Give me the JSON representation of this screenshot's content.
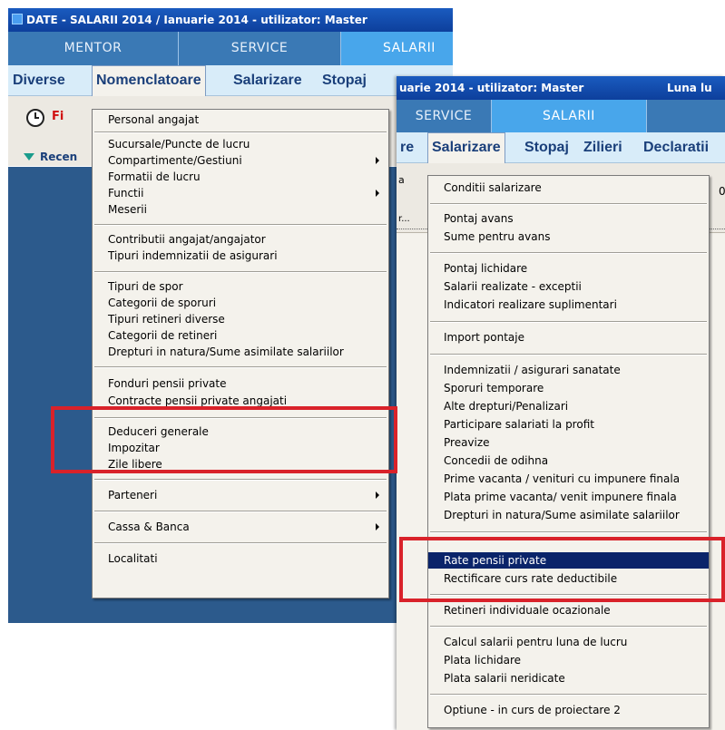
{
  "window1": {
    "title": "DATE - SALARII 2014 / Ianuarie 2014 - utilizator: Master",
    "module_tabs": [
      "MENTOR",
      "SERVICE",
      "SALARII"
    ],
    "menu": [
      "Diverse",
      "Nomenclatoare",
      "Salarizare",
      "Stopaj"
    ],
    "toolbar_label": "Fi",
    "recent_label": "Recen",
    "dropdown": [
      "Personal angajat",
      "Sucursale/Puncte de lucru",
      "Compartimente/Gestiuni",
      "Formatii de lucru",
      "Functii",
      "Meserii",
      "Contributii angajat/angajator",
      "Tipuri indemnizatii de asigurari",
      "Tipuri de spor",
      "Categorii de sporuri",
      "Tipuri retineri diverse",
      "Categorii de retineri",
      "Drepturi in natura/Sume asimilate salariilor",
      "Fonduri pensii private",
      "Contracte pensii private angajati",
      "Deduceri generale",
      "Impozitar",
      "Zile libere",
      "Parteneri",
      "Cassa & Banca",
      "Localitati"
    ]
  },
  "window2": {
    "title": "uarie 2014 - utilizator: Master",
    "title_right": "Luna lu",
    "module_tabs": [
      "SERVICE",
      "SALARII"
    ],
    "menu": [
      "re",
      "Salarizare",
      "Stopaj",
      "Zilieri",
      "Declaratii"
    ],
    "frag_a": "a",
    "frag_b": "r...",
    "frag_c": "0",
    "dropdown": [
      "Conditii salarizare",
      "Pontaj avans",
      "Sume pentru avans",
      "Pontaj lichidare",
      "Salarii realizate - exceptii",
      "Indicatori realizare suplimentari",
      "Import pontaje",
      "Indemnizatii / asigurari sanatate",
      "Sporuri temporare",
      "Alte drepturi/Penalizari",
      "Participare salariati la profit",
      "Preavize",
      "Concedii de odihna",
      "Prime vacanta / venituri cu impunere finala",
      "Plata prime vacanta/ venit impunere finala",
      "Drepturi in natura/Sume asimilate salariilor",
      "Rate pensii private",
      "Rectificare curs rate deductibile",
      "Retineri individuale ocazionale",
      "Calcul salarii pentru luna de lucru",
      "Plata lichidare",
      "Plata salarii neridicate",
      "Optiune - in curs de proiectare 2"
    ]
  },
  "colors": {
    "title_bar": "#0d3f9c",
    "module_bar": "#3a79b5",
    "active_module": "#48a6eb",
    "menu_bar": "#d8ecf9",
    "menu_text": "#1a3f7a",
    "dropdown_bg": "#f4f2ec",
    "highlight": "#0a246a",
    "desktop": "#2c5a8c",
    "annotation_red": "#d9222a"
  }
}
